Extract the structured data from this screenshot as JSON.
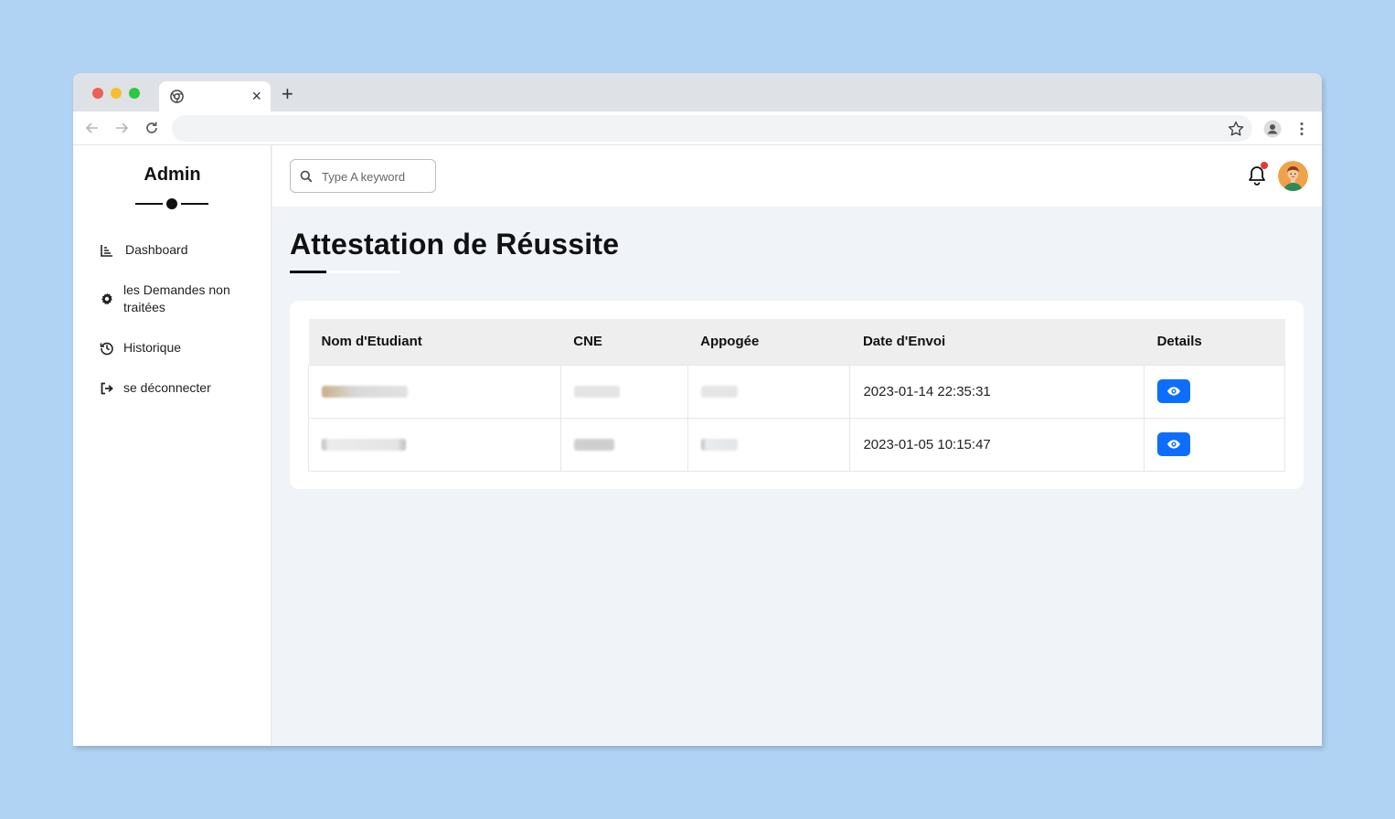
{
  "browser": {
    "tab_title": "",
    "address": ""
  },
  "sidebar": {
    "brand": "Admin",
    "items": [
      {
        "label": "Dashboard",
        "icon": "chart-icon"
      },
      {
        "label": "les Demandes non traitées",
        "icon": "gear-icon"
      },
      {
        "label": "Historique",
        "icon": "history-icon"
      },
      {
        "label": "se déconnecter",
        "icon": "logout-icon"
      }
    ]
  },
  "topbar": {
    "search_placeholder": "Type A keyword",
    "notification_dot_color": "#e53935"
  },
  "main": {
    "title": "Attestation de Réussite",
    "table": {
      "headers": [
        "Nom d'Etudiant",
        "CNE",
        "Appogée",
        "Date d'Envoi",
        "Details"
      ],
      "rows": [
        {
          "nom": "",
          "cne": "",
          "appogee": "",
          "date": "2023-01-14 22:35:31"
        },
        {
          "nom": "",
          "cne": "",
          "appogee": "",
          "date": "2023-01-05 10:15:47"
        }
      ]
    },
    "accent_color": "#0d6efd"
  }
}
